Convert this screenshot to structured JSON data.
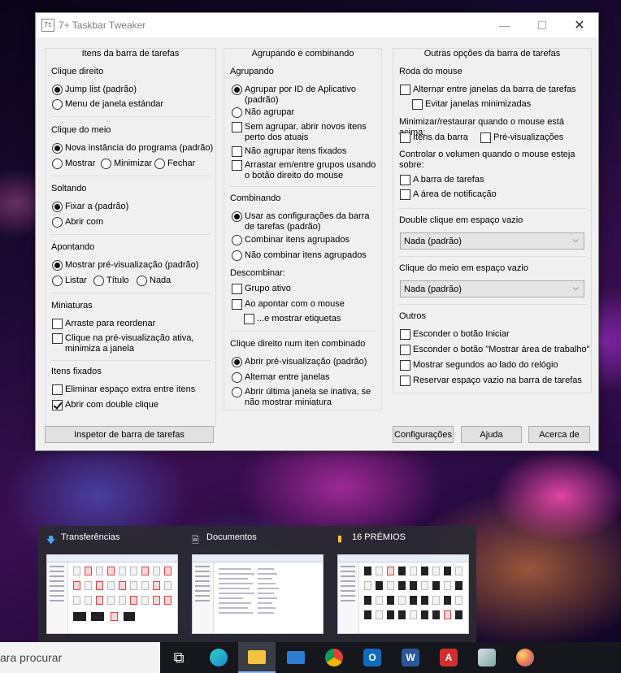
{
  "window": {
    "title": "7+ Taskbar Tweaker",
    "icon_label": "7t",
    "min": "—",
    "max": "☐",
    "close": "✕"
  },
  "col1": {
    "title": "Itens da barra de tarefas",
    "right_click": {
      "head": "Clique direito",
      "jump_list": "Jump list (padrão)",
      "std_menu": "Menu de janela estándar"
    },
    "middle_click": {
      "head": "Clique do meio",
      "new_instance": "Nova instância do programa (padrão)",
      "show": "Mostrar",
      "minimize": "Minimizar",
      "close": "Fechar"
    },
    "drop": {
      "head": "Soltando",
      "pin": "Fixar a (padrão)",
      "open_with": "Abrir com"
    },
    "hover": {
      "head": "Apontando",
      "preview": "Mostrar pré-visualização (padrão)",
      "list": "Listar",
      "title": "Título",
      "none": "Nada"
    },
    "thumbs": {
      "head": "Miniaturas",
      "drag": "Arraste para reordenar",
      "click_active": "Clique na pré-visualização ativa, minimiza a janela"
    },
    "pinned": {
      "head": "Itens fixados",
      "remove_space": "Eliminar espaço extra entre itens",
      "double_click": "Abrir com double clique"
    }
  },
  "col2": {
    "title": "Agrupando e combinando",
    "grouping": {
      "head": "Agrupando",
      "by_appid": "Agrupar por ID de Aplicativo (padrão)",
      "no_group": "Não agrupar",
      "no_group_near": "Sem agrupar, abrir novos itens perto dos atuais",
      "no_group_pinned": "Não agrupar itens fixados",
      "drag_groups": "Arrastar em/entre grupos usando o botão direito do mouse"
    },
    "combining": {
      "head": "Combinando",
      "use_settings": "Usar as configurações da barra de tarefas (padrão)",
      "combine": "Combinar itens agrupados",
      "no_combine": "Não combinar itens agrupados"
    },
    "decombine": {
      "head": "Descombinar:",
      "active": "Grupo ativo",
      "hover": "Ao apontar com o mouse",
      "labels": "...e mostrar etiquetas"
    },
    "right_click_combined": {
      "head": "Clique direito num iten combinado",
      "open_preview": "Abrir pré-visualização (padrão)",
      "switch": "Alternar entre janelas",
      "open_last": "Abrir última janela se inativa, se não mostrar miniatura"
    }
  },
  "col3": {
    "title": "Outras opções da barra de tarefas",
    "wheel": {
      "head": "Roda do mouse",
      "switch_windows": "Alternar entre janelas da barra de tarefas",
      "skip_minimized": "Evitar janelas minimizadas",
      "minrestore_head": "Minimizar/restaurar quando o mouse está acima:",
      "items": "Itens da barra",
      "previews": "Pré-visualizações",
      "volume_head": "Controlar o volumen quando o mouse esteja sobre:",
      "taskbar": "A barra de tarefas",
      "notif_area": "A área de notificação"
    },
    "dbl_click": {
      "head": "Double clique em espaço vazio",
      "value": "Nada (padrão)"
    },
    "mid_click": {
      "head": "Clique do meio em espaço vazio",
      "value": "Nada (padrão)"
    },
    "others": {
      "head": "Outros",
      "hide_start": "Esconder o botão Iniciar",
      "hide_desktop": "Esconder o botão \"Mostrar área de trabalho\"",
      "show_seconds": "Mostrar segundos ao lado do relógio",
      "reserve_space": "Reservar espaço vazio na barra de tarefas"
    }
  },
  "buttons": {
    "inspector": "Inspetor de barra de tarefas",
    "settings": "Configurações",
    "help": "Ajuda",
    "about": "Acerca de"
  },
  "flyout": {
    "items": [
      {
        "title": "Transferências",
        "icon": "download-arrow-icon"
      },
      {
        "title": "Documentos",
        "icon": "document-icon"
      },
      {
        "title": "16 PRÉMIOS",
        "icon": "folder-icon"
      }
    ]
  },
  "taskbar": {
    "search_text": "ara procurar",
    "word_letter": "W",
    "outlook_letter": "O",
    "pdf_letter": "A",
    "task_view_glyph": "⧉",
    "colors": {
      "edge": "#1e88d8",
      "explorer": "#f5c242",
      "mail": "#2b7cd3",
      "chrome": "#db4437",
      "outlook": "#0f6cbd",
      "word": "#2b579a",
      "acrobat": "#d32f2f"
    }
  }
}
